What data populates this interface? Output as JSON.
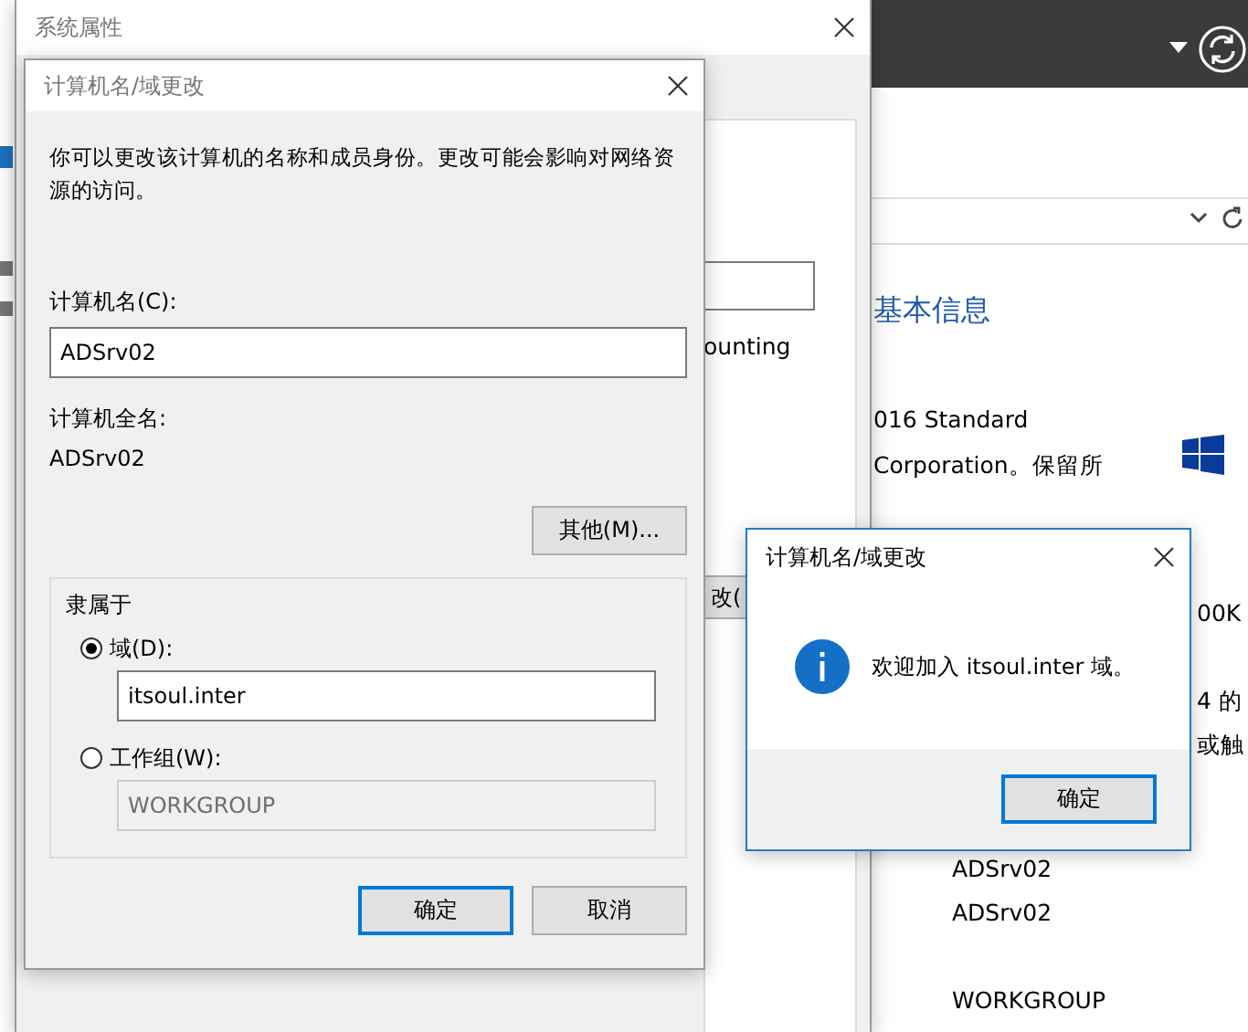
{
  "background_app": {
    "heading": "基本信息",
    "lines": [
      "016 Standard",
      "Corporation。保留所",
      "00K",
      "4 的",
      "或触"
    ],
    "computer_lines": [
      "ADSrv02",
      "ADSrv02",
      "WORKGROUP"
    ]
  },
  "system_properties": {
    "title": "系统属性",
    "fragment": "ounting",
    "button": "改("
  },
  "dialog": {
    "title": "计算机名/域更改",
    "description": "你可以更改该计算机的名称和成员身份。更改可能会影响对网络资源的访问。",
    "name_label": "计算机名(C):",
    "name_value": "ADSrv02",
    "full_name_label": "计算机全名:",
    "full_name": "ADSrv02",
    "more_button": "其他(M)...",
    "group_title": "隶属于",
    "members": [
      {
        "label": "域(D):",
        "selected": true,
        "value": "itsoul.inter"
      },
      {
        "label": "工作组(W):",
        "selected": false,
        "value": "WORKGROUP"
      }
    ],
    "buttons": [
      {
        "label": "确定",
        "default": true
      },
      {
        "label": "取消",
        "default": false
      }
    ]
  },
  "message_box": {
    "title": "计算机名/域更改",
    "message": "欢迎加入 itsoul.inter 域。",
    "button": "确定"
  }
}
